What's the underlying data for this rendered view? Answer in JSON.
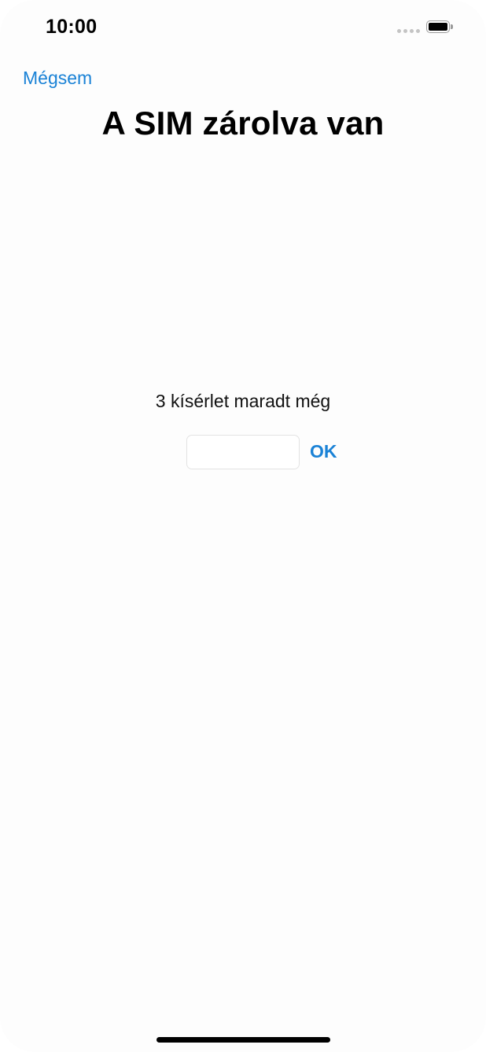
{
  "status_bar": {
    "time": "10:00",
    "battery_level": 1.0
  },
  "nav": {
    "cancel_label": "Mégsem"
  },
  "header": {
    "title": "A SIM zárolva van"
  },
  "main": {
    "attempts_text": "3 kísérlet maradt még",
    "pin_input_value": "",
    "pin_input_placeholder": "",
    "ok_label": "OK"
  },
  "colors": {
    "accent": "#1a82d6",
    "background": "#fdfdfd",
    "text": "#000000"
  },
  "icons": {
    "signal": "signal-dots-icon",
    "battery": "battery-icon"
  }
}
